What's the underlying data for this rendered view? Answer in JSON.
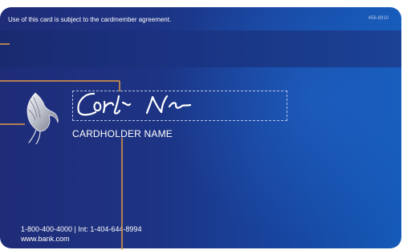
{
  "card": {
    "agreement_text": "Use of this card is subject to the cardmember agreement.",
    "card_number": "456-8910",
    "signature_text": "Cardholder Name",
    "cardholder_label": "CARDHOLDER NAME",
    "phone_line": "1-800-400-4000 | Int: 1-404-644-8994",
    "website": "www.bank.com"
  },
  "colors": {
    "card_dark": "#1f2c78",
    "card_light": "#155ab8",
    "stripe": "#1a3382",
    "callout_line": "#e39a45",
    "text": "#ffffff"
  },
  "icons": {
    "bird": "dove-icon"
  }
}
